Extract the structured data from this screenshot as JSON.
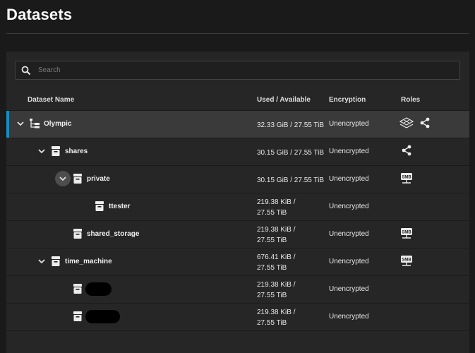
{
  "page": {
    "title": "Datasets"
  },
  "search": {
    "placeholder": "Search"
  },
  "table": {
    "headers": {
      "name": "Dataset Name",
      "used": "Used / Available",
      "encryption": "Encryption",
      "roles": "Roles"
    },
    "rows": [
      {
        "name": "Olympic",
        "used": "32.33 GiB / 27.55 TiB",
        "encryption": "Unencrypted",
        "roles": [
          "dataset-tree-icon",
          "share-icon"
        ],
        "expanded": true,
        "selected": true
      },
      {
        "name": "shares",
        "used": "30.15 GiB / 27.55 TiB",
        "encryption": "Unencrypted",
        "roles": [
          "share-icon"
        ],
        "expanded": true
      },
      {
        "name": "private",
        "used": "30.15 GiB / 27.55 TiB",
        "encryption": "Unencrypted",
        "roles": [
          "smb-icon"
        ],
        "expanded": true
      },
      {
        "name": "ttester",
        "used_line1": "219.38 KiB /",
        "used_line2": "27.55 TiB",
        "encryption": "Unencrypted",
        "roles": []
      },
      {
        "name": "shared_storage",
        "used_line1": "219.38 KiB /",
        "used_line2": "27.55 TiB",
        "encryption": "Unencrypted",
        "roles": [
          "smb-icon"
        ]
      },
      {
        "name": "time_machine",
        "used_line1": "676.41 KiB /",
        "used_line2": "27.55 TiB",
        "encryption": "Unencrypted",
        "roles": [
          "smb-icon"
        ],
        "expanded": true
      },
      {
        "used_line1": "219.38 KiB /",
        "used_line2": "27.55 TiB",
        "encryption": "Unencrypted",
        "roles": []
      },
      {
        "used_line1": "219.38 KiB /",
        "used_line2": "27.55 TiB",
        "encryption": "Unencrypted",
        "roles": []
      }
    ]
  },
  "colors": {
    "accent": "#0095d5",
    "background": "#1a1a1a",
    "panel": "#262626",
    "selected_row": "#3a3a3a"
  }
}
